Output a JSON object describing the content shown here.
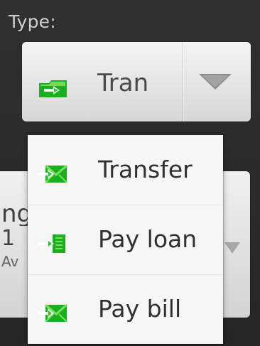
{
  "screen": {
    "type_label": "Type:",
    "selected_type": {
      "label": "Tran",
      "icon": "transfer-folder-icon"
    },
    "background_spinner": {
      "line1": "ng",
      "line2": "1",
      "line3": "Av"
    },
    "dropdown_options": [
      {
        "label": "Transfer",
        "icon": "transfer-envelope-icon"
      },
      {
        "label": "Pay loan",
        "icon": "pay-loan-icon"
      },
      {
        "label": "Pay bill",
        "icon": "pay-bill-envelope-icon"
      }
    ],
    "colors": {
      "dark_background": "#2b2b2b",
      "dropdown_background": "#f6f6f6",
      "icon_green": "#17b11d",
      "icon_green_light": "#7be05e",
      "label_text": "#303030"
    }
  }
}
